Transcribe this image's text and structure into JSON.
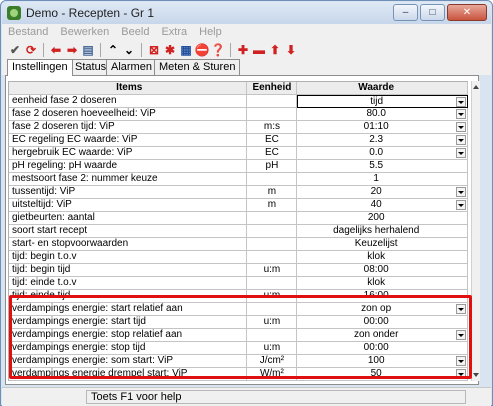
{
  "window": {
    "title": "Demo - Recepten - Gr 1",
    "minimize": "–",
    "maximize": "□",
    "close": "✕"
  },
  "menu": [
    "Bestand",
    "Bewerken",
    "Beeld",
    "Extra",
    "Help"
  ],
  "toolbar": {
    "icons": [
      "check-icon",
      "refresh-icon",
      "arrow-left-icon",
      "arrow-right-icon",
      "list-icon",
      "collapse-icon",
      "expand-icon",
      "delete-icon",
      "asterisk-icon",
      "print-icon",
      "stop-icon",
      "help-icon",
      "add-icon",
      "remove-icon",
      "move-up-icon",
      "move-down-icon"
    ],
    "colors": {
      "red": "#e01010",
      "green": "#2e8b2e",
      "blue": "#2050a0"
    }
  },
  "tabs": [
    "Instellingen",
    "Status",
    "Alarmen",
    "Meten & Sturen"
  ],
  "table": {
    "headers": {
      "items": "Items",
      "unit": "Eenheid",
      "value": "Waarde"
    },
    "rows": [
      {
        "item": "eenheid fase 2 doseren",
        "unit": "",
        "value": "tijd",
        "dropdown": true,
        "selected": true
      },
      {
        "item": "fase 2 doseren hoeveelheid: ViP",
        "unit": "",
        "value": "80.0",
        "dropdown": true
      },
      {
        "item": "fase 2 doseren tijd: ViP",
        "unit": "m:s",
        "value": "01:10",
        "dropdown": true
      },
      {
        "item": "EC regeling EC waarde: ViP",
        "unit": "EC",
        "value": "2.3",
        "dropdown": true
      },
      {
        "item": "hergebruik EC waarde: ViP",
        "unit": "EC",
        "value": "0.0",
        "dropdown": true
      },
      {
        "item": "pH regeling: pH waarde",
        "unit": "pH",
        "value": "5.5",
        "dropdown": false
      },
      {
        "item": "mestsoort fase 2: nummer keuze",
        "unit": "",
        "value": "1",
        "dropdown": false
      },
      {
        "item": "tussentijd: ViP",
        "unit": "m",
        "value": "20",
        "dropdown": true
      },
      {
        "item": "uitsteltijd: ViP",
        "unit": "m",
        "value": "40",
        "dropdown": true
      },
      {
        "item": "gietbeurten: aantal",
        "unit": "",
        "value": "200",
        "dropdown": false
      },
      {
        "item": "soort start recept",
        "unit": "",
        "value": "dagelijks herhalend",
        "dropdown": false
      },
      {
        "item": "start- en stopvoorwaarden",
        "unit": "",
        "value": "Keuzelijst",
        "dropdown": false
      },
      {
        "item": "tijd: begin t.o.v",
        "unit": "",
        "value": "klok",
        "dropdown": false
      },
      {
        "item": "tijd: begin tijd",
        "unit": "u:m",
        "value": "08:00",
        "dropdown": false
      },
      {
        "item": "tijd: einde t.o.v",
        "unit": "",
        "value": "klok",
        "dropdown": false
      },
      {
        "item": "tijd: einde tijd",
        "unit": "u:m",
        "value": "16:00",
        "dropdown": false
      },
      {
        "item": "verdampings energie: start relatief aan",
        "unit": "",
        "value": "zon op",
        "dropdown": true
      },
      {
        "item": "verdampings energie: start tijd",
        "unit": "u:m",
        "value": "00:00",
        "dropdown": false
      },
      {
        "item": "verdampings energie: stop relatief aan",
        "unit": "",
        "value": "zon onder",
        "dropdown": true
      },
      {
        "item": "verdampings energie: stop tijd",
        "unit": "u:m",
        "value": "00:00",
        "dropdown": false
      },
      {
        "item": "verdampings energie: som start: ViP",
        "unit": "J/cm²",
        "value": "100",
        "dropdown": true
      },
      {
        "item": "verdampings energie drempel start: ViP",
        "unit": "W/m²",
        "value": "50",
        "dropdown": true
      }
    ]
  },
  "status": {
    "text": "Toets F1 voor help"
  }
}
